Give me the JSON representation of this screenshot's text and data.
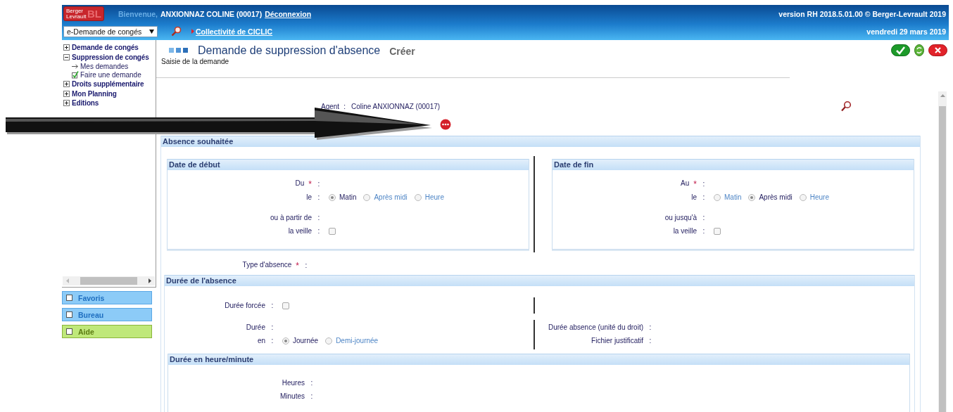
{
  "header": {
    "logo": {
      "lines": [
        "Berger",
        "Levrault"
      ],
      "monogram": "BL"
    },
    "greeting": "Bienvenue,",
    "user": "ANXIONNAZ COLINE (00017)",
    "logout": "Déconnexion",
    "version": "version RH 2018.5.01.00 © Berger-Levrault 2019",
    "module_select": "e-Demande de congés",
    "collectivity": "Collectivité de CICLIC",
    "date": "vendredi 29 mars 2019"
  },
  "sidebar": {
    "tree": [
      {
        "label": "Demande de congés",
        "expanded": false
      },
      {
        "label": "Suppression de congés",
        "expanded": true,
        "children": [
          {
            "label": "Mes demandes",
            "kind": "arrow"
          },
          {
            "label": "Faire une demande",
            "kind": "check"
          }
        ]
      },
      {
        "label": "Droits supplémentaire",
        "expanded": false
      },
      {
        "label": "Mon Planning",
        "expanded": false
      },
      {
        "label": "Editions",
        "expanded": false
      }
    ],
    "panels": [
      {
        "label": "Favoris",
        "color": "#8ccbf7"
      },
      {
        "label": "Bureau",
        "color": "#8ccbf7"
      },
      {
        "label": "Aide",
        "color": "#bfe87a"
      }
    ]
  },
  "page": {
    "title": "Demande de suppression d'absence",
    "mode": "Créer",
    "subtitle": "Saisie de la demande",
    "actions": [
      {
        "kind": "validate"
      },
      {
        "kind": "refresh"
      },
      {
        "kind": "cancel"
      }
    ]
  },
  "agent": {
    "label": "Agent",
    "sep": ":",
    "value": "Coline ANXIONNAZ (00017)"
  },
  "absence": {
    "title": "Absence souhaitée",
    "panels": [
      {
        "title": "Date de début",
        "fields": [
          {
            "label": "Du",
            "mark": "*",
            "sep": ":"
          },
          {
            "label": "le",
            "sep": ":",
            "kind": "radio",
            "options": [
              {
                "label": "Matin",
                "selected": true
              },
              {
                "label": "Après midi",
                "selected": false
              },
              {
                "label": "Heure",
                "selected": false
              }
            ]
          },
          {
            "label": "ou à partir de",
            "sep": ":"
          },
          {
            "label": "la veille",
            "sep": ":",
            "kind": "checkbox",
            "checked": false
          }
        ]
      },
      {
        "title": "Date de fin",
        "fields": [
          {
            "label": "Au",
            "mark": "*",
            "sep": ":"
          },
          {
            "label": "le",
            "sep": ":",
            "kind": "radio",
            "options": [
              {
                "label": "Matin",
                "selected": false
              },
              {
                "label": "Après midi",
                "selected": true
              },
              {
                "label": "Heure",
                "selected": false
              }
            ]
          },
          {
            "label": "ou jusqu'à",
            "sep": ":"
          },
          {
            "label": "la veille",
            "sep": ":",
            "kind": "checkbox",
            "checked": false
          }
        ]
      }
    ],
    "type_field": {
      "label": "Type d'absence",
      "mark": "*",
      "sep": ":"
    }
  },
  "duration": {
    "title": "Durée de l'absence",
    "forced": {
      "label": "Durée forcée",
      "sep": ":",
      "kind": "checkbox",
      "checked": false
    },
    "left": [
      {
        "label": "Durée",
        "sep": ":"
      },
      {
        "label": "en",
        "sep": ":",
        "kind": "radio",
        "options": [
          {
            "label": "Journée",
            "selected": true
          },
          {
            "label": "Demi-journée",
            "selected": false
          }
        ]
      }
    ],
    "right": [
      {
        "label": "Durée absence (unité du droit)",
        "sep": ":"
      },
      {
        "label": "Fichier justificatif",
        "sep": ":"
      }
    ],
    "hours_panel": {
      "title": "Durée en heure/minute",
      "fields": [
        {
          "label": "Heures",
          "sep": ":"
        },
        {
          "label": "Minutes",
          "sep": ":"
        }
      ]
    }
  }
}
